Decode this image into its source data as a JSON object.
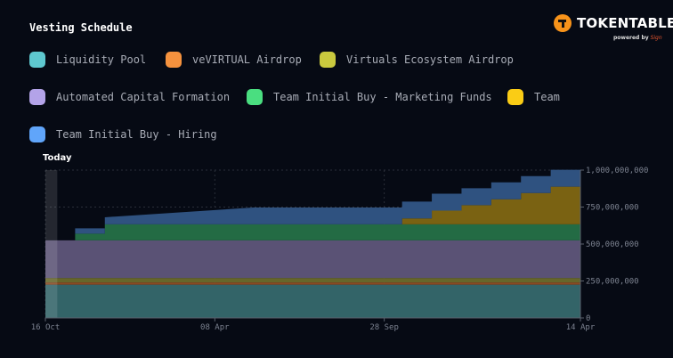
{
  "header": {
    "title": "Vesting Schedule",
    "brand": "TOKENTABLE",
    "powered_by": "powered by",
    "powered_by_brand": "Sign"
  },
  "chart_data": {
    "type": "area",
    "stacked": true,
    "step": true,
    "today_label": "Today",
    "today_x": 0.4,
    "x_unit": "months since 16 Oct",
    "xlim": [
      0,
      18
    ],
    "ylim": [
      0,
      1000000000
    ],
    "x_ticks": [
      {
        "x": 0,
        "label": "16 Oct"
      },
      {
        "x": 5.7,
        "label": "08 Apr"
      },
      {
        "x": 11.4,
        "label": "28 Sep"
      },
      {
        "x": 18,
        "label": "14 Apr"
      }
    ],
    "y_ticks": [
      {
        "y": 0,
        "label": "0"
      },
      {
        "y": 250000000,
        "label": "250,000,000"
      },
      {
        "y": 500000000,
        "label": "500,000,000"
      },
      {
        "y": 750000000,
        "label": "750,000,000"
      },
      {
        "y": 1000000000,
        "label": "1,000,000,000"
      }
    ],
    "grid": true,
    "legend_position": "top-left",
    "series": [
      {
        "name": "Liquidity Pool",
        "color": "#5ec8cf",
        "fill": "#336468",
        "points": [
          [
            0,
            225
          ],
          [
            18,
            225
          ]
        ]
      },
      {
        "name": "veVIRTUAL Airdrop",
        "color": "#f5923e",
        "fill": "#8a4a22",
        "points": [
          [
            0,
            15
          ],
          [
            18,
            15
          ]
        ]
      },
      {
        "name": "Virtuals Ecosystem Airdrop",
        "color": "#c9c93e",
        "fill": "#66662a",
        "points": [
          [
            0,
            30
          ],
          [
            18,
            30
          ]
        ]
      },
      {
        "name": "Automated Capital Formation",
        "color": "#b3a3e8",
        "fill": "#5a5275",
        "points": [
          [
            0,
            255
          ],
          [
            18,
            255
          ]
        ]
      },
      {
        "name": "Team Initial Buy - Marketing Funds",
        "color": "#4ade80",
        "fill": "#236b44",
        "points": [
          [
            0,
            0
          ],
          [
            1,
            0
          ],
          [
            1,
            45
          ],
          [
            2,
            45
          ],
          [
            2,
            108
          ],
          [
            18,
            108
          ]
        ]
      },
      {
        "name": "Team",
        "color": "#facc15",
        "fill": "#7a6212",
        "points": [
          [
            0,
            0
          ],
          [
            12,
            0
          ],
          [
            12,
            40
          ],
          [
            13,
            40
          ],
          [
            13,
            93
          ],
          [
            14,
            93
          ],
          [
            14,
            130
          ],
          [
            15,
            130
          ],
          [
            15,
            170
          ],
          [
            16,
            170
          ],
          [
            16,
            212
          ],
          [
            17,
            212
          ],
          [
            17,
            255
          ],
          [
            18,
            255
          ]
        ]
      },
      {
        "name": "Team Initial Buy - Hiring",
        "color": "#60a5fa",
        "fill": "#2f5280",
        "points": [
          [
            0,
            0
          ],
          [
            1,
            0
          ],
          [
            1,
            36
          ],
          [
            2,
            36
          ],
          [
            2,
            48
          ],
          [
            7,
            114
          ],
          [
            18,
            114
          ]
        ]
      }
    ],
    "legend_order": [
      0,
      1,
      2,
      3,
      4,
      5,
      6
    ]
  }
}
